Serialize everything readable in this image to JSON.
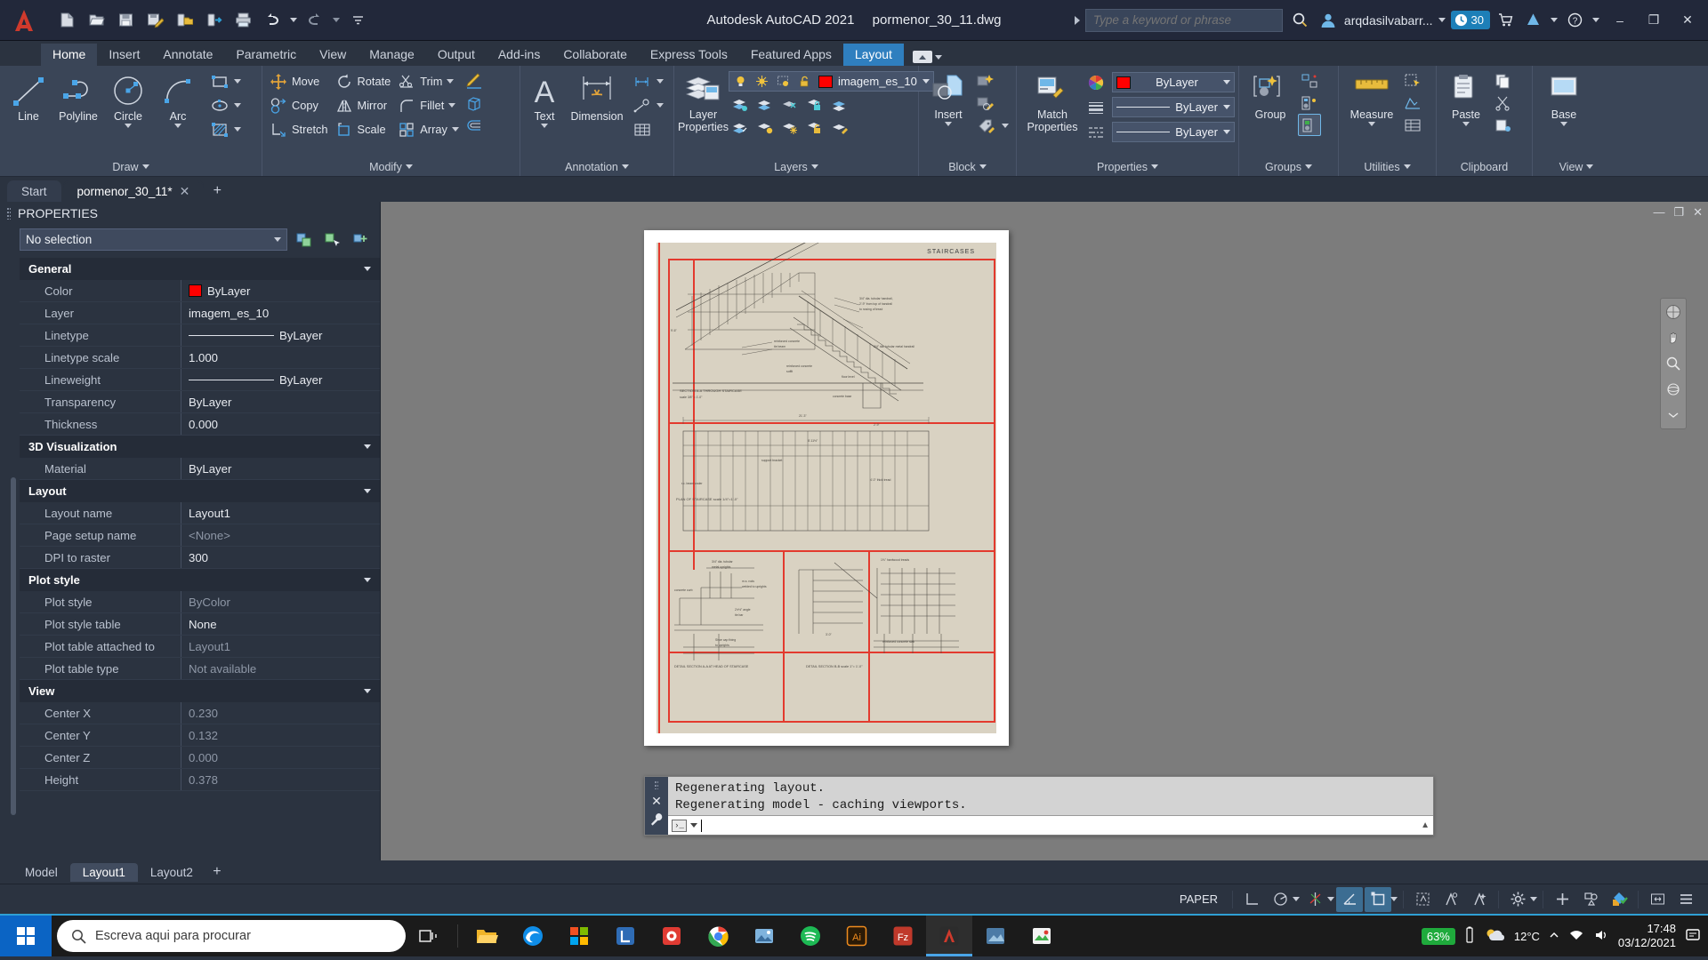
{
  "titlebar": {
    "app_title": "Autodesk AutoCAD 2021",
    "file_name": "pormenor_30_11.dwg",
    "qat": [
      {
        "name": "new-file-icon",
        "label": "New"
      },
      {
        "name": "open-file-icon",
        "label": "Open"
      },
      {
        "name": "save-icon",
        "label": "Save"
      },
      {
        "name": "save-as-icon",
        "label": "Save As"
      },
      {
        "name": "open-from-web-icon",
        "label": "Open from Web & Mobile"
      },
      {
        "name": "save-to-web-icon",
        "label": "Save to Web & Mobile"
      },
      {
        "name": "plot-icon",
        "label": "Plot"
      },
      {
        "name": "undo-icon",
        "label": "Undo"
      },
      {
        "name": "redo-icon",
        "label": "Redo"
      },
      {
        "name": "customize-qat-icon",
        "label": "Customize Quick Access Toolbar"
      }
    ],
    "search_placeholder": "Type a keyword or phrase",
    "search_value": "",
    "user_name": "arqdasilvabarr...",
    "badge_count": "30",
    "window_buttons": {
      "minimize": "–",
      "restore": "❐",
      "close": "✕"
    }
  },
  "ribbon": {
    "tabs": [
      {
        "label": "Home",
        "state": "active"
      },
      {
        "label": "Insert",
        "state": ""
      },
      {
        "label": "Annotate",
        "state": ""
      },
      {
        "label": "Parametric",
        "state": ""
      },
      {
        "label": "View",
        "state": ""
      },
      {
        "label": "Manage",
        "state": ""
      },
      {
        "label": "Output",
        "state": ""
      },
      {
        "label": "Add-ins",
        "state": ""
      },
      {
        "label": "Collaborate",
        "state": ""
      },
      {
        "label": "Express Tools",
        "state": ""
      },
      {
        "label": "Featured Apps",
        "state": ""
      },
      {
        "label": "Layout",
        "state": "highlight"
      }
    ],
    "panels": [
      {
        "title": "Draw",
        "big_buttons": [
          "Line",
          "Polyline",
          "Circle",
          "Arc"
        ],
        "small_items": [
          "Rectangle",
          "Ellipse",
          "Hatch"
        ]
      },
      {
        "title": "Modify",
        "col1": [
          "Move",
          "Copy",
          "Stretch"
        ],
        "col2": [
          "Rotate",
          "Mirror",
          "Scale"
        ],
        "col3": [
          "Trim",
          "Fillet",
          "Array"
        ],
        "col4": [
          "Erase-brush",
          "Extrude-box",
          "Offset"
        ]
      },
      {
        "title": "Annotation",
        "big_buttons": [
          "Text",
          "Dimension"
        ],
        "small_items": [
          "Linear",
          "Leader",
          "Table"
        ]
      },
      {
        "title": "Layers",
        "big_buttons": [
          "Layer Properties"
        ],
        "layer_combo": {
          "value": "imagem_es_10",
          "color": "#ff0000"
        }
      },
      {
        "title": "Block",
        "big_buttons": [
          "Insert"
        ]
      },
      {
        "title": "Properties",
        "big_buttons": [
          "Match Properties"
        ],
        "combos": [
          {
            "name": "color",
            "value": "ByLayer",
            "swatch": "#ff0000"
          },
          {
            "name": "lineweight",
            "value": "ByLayer"
          },
          {
            "name": "linetype",
            "value": "ByLayer"
          }
        ]
      },
      {
        "title": "Groups",
        "big_buttons": [
          "Group"
        ]
      },
      {
        "title": "Utilities",
        "big_buttons": [
          "Measure"
        ]
      },
      {
        "title": "Clipboard",
        "big_buttons": [
          "Paste"
        ]
      },
      {
        "title": "View",
        "big_buttons": [
          "Base"
        ]
      }
    ]
  },
  "doc_tabs": [
    {
      "label": "Start",
      "active": false,
      "closable": false
    },
    {
      "label": "pormenor_30_11*",
      "active": true,
      "closable": true
    }
  ],
  "properties": {
    "panel_title": "PROPERTIES",
    "selection": "No selection",
    "toolbar_icons": [
      "quick-select-icon",
      "select-objects-icon",
      "pickadd-icon"
    ],
    "groups": [
      {
        "name": "General",
        "rows": [
          {
            "key": "Color",
            "value": "ByLayer",
            "swatch": "#ff0000",
            "dim": false
          },
          {
            "key": "Layer",
            "value": "imagem_es_10",
            "dim": false
          },
          {
            "key": "Linetype",
            "value": "ByLayer",
            "line": true,
            "dim": false
          },
          {
            "key": "Linetype scale",
            "value": "1.000",
            "dim": false
          },
          {
            "key": "Lineweight",
            "value": "ByLayer",
            "line": true,
            "dim": false
          },
          {
            "key": "Transparency",
            "value": "ByLayer",
            "dim": false
          },
          {
            "key": "Thickness",
            "value": "0.000",
            "dim": false
          }
        ]
      },
      {
        "name": "3D Visualization",
        "rows": [
          {
            "key": "Material",
            "value": "ByLayer",
            "dim": false
          }
        ]
      },
      {
        "name": "Layout",
        "rows": [
          {
            "key": "Layout name",
            "value": "Layout1",
            "dim": false
          },
          {
            "key": "Page setup name",
            "value": "<None>",
            "dim": true
          },
          {
            "key": "DPI to raster",
            "value": "300",
            "dim": false
          }
        ]
      },
      {
        "name": "Plot style",
        "rows": [
          {
            "key": "Plot style",
            "value": "ByColor",
            "dim": true
          },
          {
            "key": "Plot style table",
            "value": "None",
            "dim": false
          },
          {
            "key": "Plot table attached to",
            "value": "Layout1",
            "dim": true
          },
          {
            "key": "Plot table type",
            "value": "Not available",
            "dim": true
          }
        ]
      },
      {
        "name": "View",
        "rows": [
          {
            "key": "Center X",
            "value": "0.230",
            "dim": true
          },
          {
            "key": "Center Y",
            "value": "0.132",
            "dim": true
          },
          {
            "key": "Center Z",
            "value": "0.000",
            "dim": true
          },
          {
            "key": "Height",
            "value": "0.378",
            "dim": true
          }
        ]
      }
    ]
  },
  "drawing": {
    "sheet_title": "STAIRCASES",
    "annotations": [
      "3/4\" dia. tubular handrail,",
      "2'-9\" from top of handrail",
      "to nosing of tread",
      "reinforced concrete",
      "tie beam",
      "reinforced concrete",
      "soffit",
      "floor level",
      "concrete base",
      "SECTION A-A  THROUGH STAIRCASE",
      "scale 3/8\" = 1'-0\"",
      "PLAN OF STAIRCASE   scale 1/4\"=1'-0\"",
      "DETAIL SECTION A-A  AT HEAD OF STAIRCASE",
      "DETAIL SECTION B-B   scale 1\"= 1'-0\"",
      "3/4\" dia. tubular metal handrail",
      "support bracket",
      "r.c. beam under",
      "1'-0\"",
      "9'-6\"",
      "2'-9\"",
      "21'-3\"",
      "8'-11½\"",
      "4'-0\" thick tread",
      "3/4\" dia. tubular metal uprights",
      "concrete curb",
      "m.s. rods welded to uprights",
      "tread fixing to r.c. beam",
      "2'x½\" angle tie bar",
      "shoe cap fixing to uprights",
      "1⅛\" hardwood treads",
      "reinforced concrete slab"
    ]
  },
  "viewport_controls": [
    "minimize-viewport-icon",
    "maximize-viewport-icon",
    "close-viewport-icon"
  ],
  "command_line": {
    "history": [
      "Regenerating layout.",
      "Regenerating model - caching viewports."
    ],
    "input_value": "",
    "close_icon": "X",
    "customize_icon": "wrench-icon"
  },
  "layout_tabs": [
    {
      "label": "Model",
      "active": false
    },
    {
      "label": "Layout1",
      "active": true
    },
    {
      "label": "Layout2",
      "active": false
    }
  ],
  "statusbar": {
    "space_mode": "PAPER",
    "items": [
      {
        "name": "model-space-icon",
        "on": false,
        "caret": false
      },
      {
        "name": "snap-mode-icon",
        "on": false,
        "caret": true
      },
      {
        "name": "ortho-grid-icon",
        "on": false,
        "caret": true
      },
      {
        "name": "polar-tracking-icon",
        "on": true,
        "caret": false
      },
      {
        "name": "object-snap-icon",
        "on": true,
        "caret": true
      },
      {
        "name": "annotation-visibility-icon",
        "on": false,
        "caret": false
      },
      {
        "name": "annotation-scale-icon",
        "on": false,
        "caret": false
      },
      {
        "name": "auto-scale-icon",
        "on": false,
        "caret": false
      },
      {
        "name": "workspace-gear-icon",
        "on": false,
        "caret": true
      },
      {
        "name": "hardware-accel-icon",
        "on": false,
        "caret": false
      },
      {
        "name": "isolate-objects-icon",
        "on": false,
        "caret": false
      },
      {
        "name": "clean-screen-icon",
        "on": false,
        "caret": false
      },
      {
        "name": "fullscreen-icon",
        "on": false,
        "caret": false
      },
      {
        "name": "customization-menu-icon",
        "on": false,
        "caret": false
      }
    ]
  },
  "taskbar": {
    "search_placeholder": "Escreva aqui para procurar",
    "apps": [
      {
        "name": "task-view-icon"
      },
      {
        "name": "file-explorer-icon"
      },
      {
        "name": "microsoft-edge-icon"
      },
      {
        "name": "microsoft-store-icon"
      },
      {
        "name": "liberty-app-icon"
      },
      {
        "name": "orange-app-icon"
      },
      {
        "name": "google-chrome-icon"
      },
      {
        "name": "photos-icon"
      },
      {
        "name": "spotify-icon"
      },
      {
        "name": "adobe-illustrator-icon"
      },
      {
        "name": "filezilla-icon"
      },
      {
        "name": "autocad-icon"
      },
      {
        "name": "blue-app-icon"
      },
      {
        "name": "paint3d-icon"
      }
    ],
    "battery": "63%",
    "weather": "12°C",
    "time": "17:48",
    "date": "03/12/2021"
  }
}
